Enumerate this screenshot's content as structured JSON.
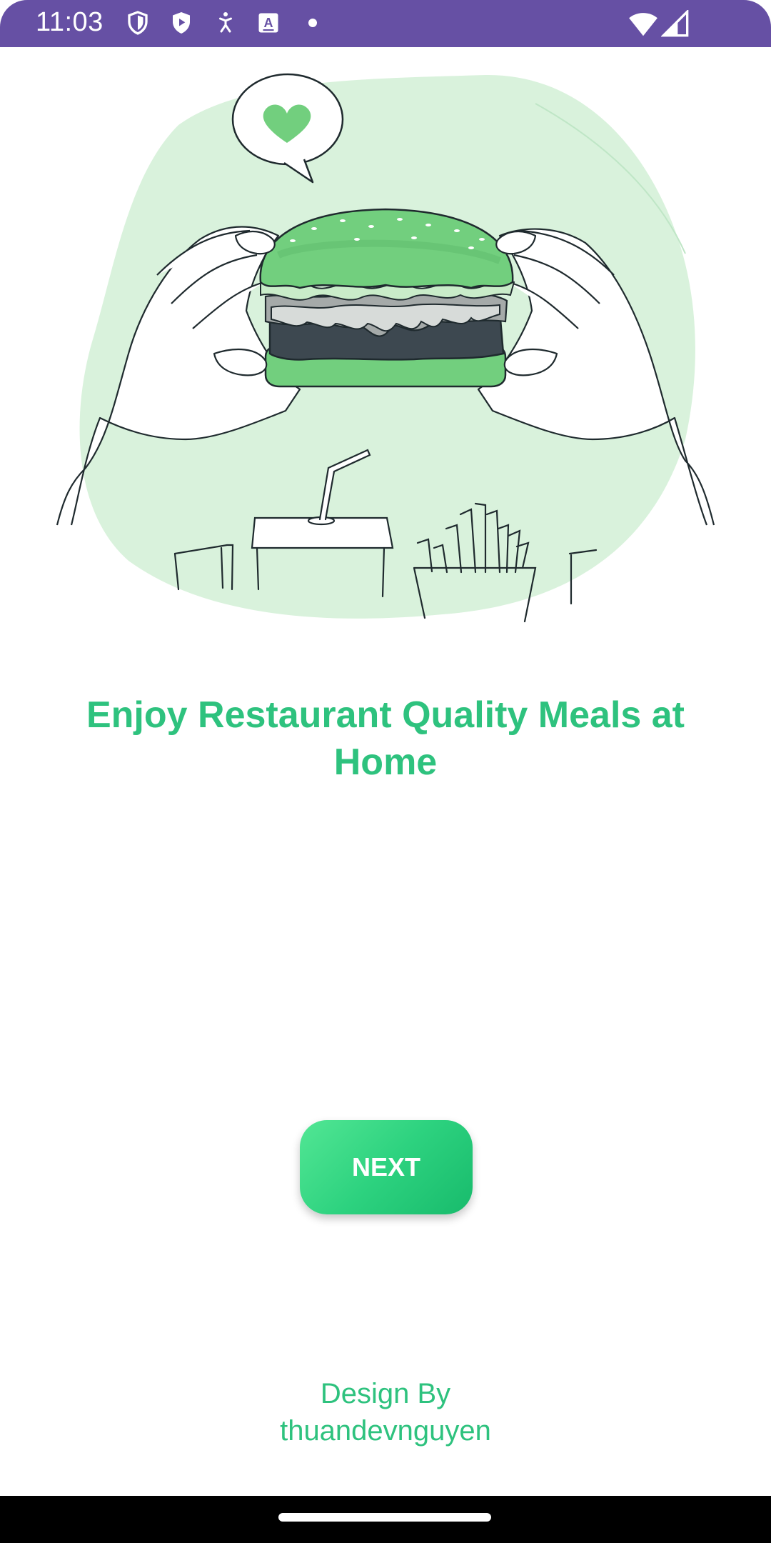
{
  "status_bar": {
    "time": "11:03",
    "background": "#6650a4",
    "left_icons": [
      "shield-icon",
      "play-protect-icon",
      "accessibility-icon",
      "keyboard-a-icon",
      "notification-dot-icon"
    ],
    "right_icons": [
      "wifi-icon",
      "cellular-signal-icon"
    ]
  },
  "main": {
    "illustration_icon": "burger-hands-illustration",
    "headline": "Enjoy Restaurant Quality Meals at Home",
    "next_label": "NEXT",
    "credit_line1": "Design By",
    "credit_line2": "thuandevnguyen"
  },
  "colors": {
    "accent": "#2ec27e",
    "button_gradient_start": "#52e694",
    "button_gradient_end": "#18bb6c",
    "illustration_blob": "#d9f2dc",
    "burger_bun": "#72cf7e"
  }
}
